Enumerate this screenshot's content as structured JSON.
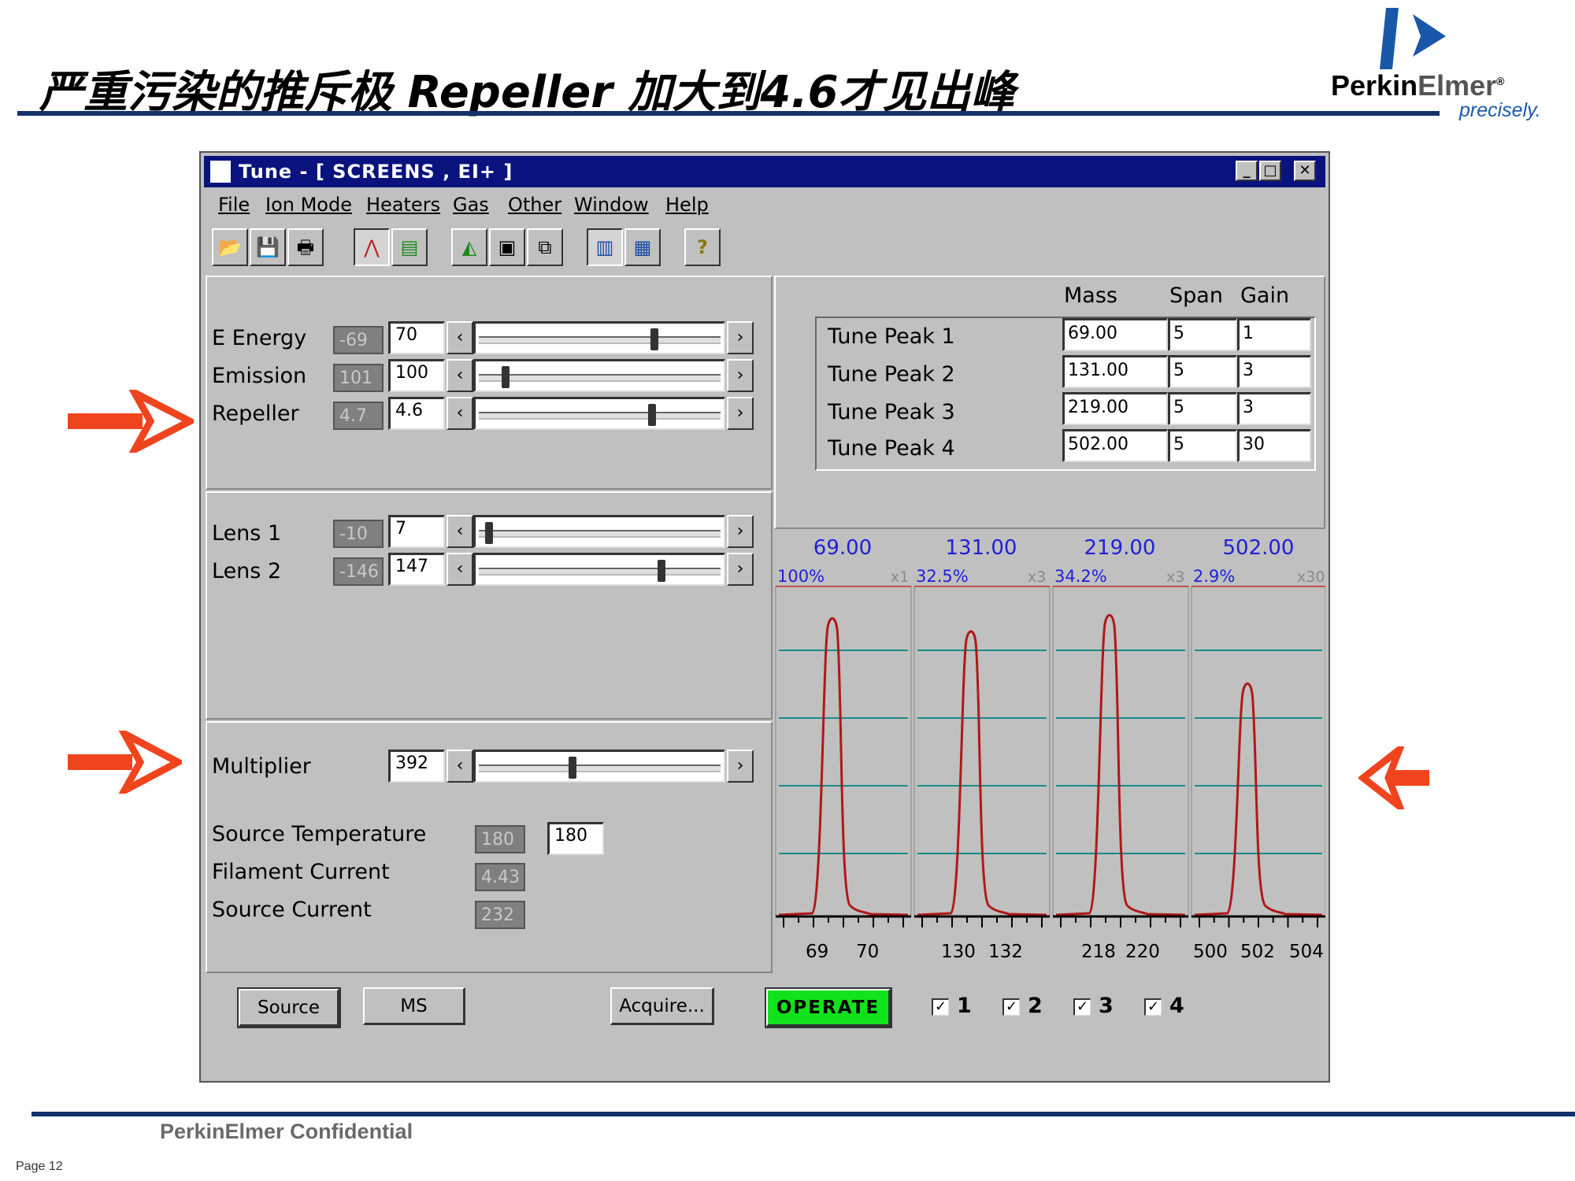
{
  "slide": {
    "title": "严重污染的推斥极    Repeller 加大到4.6才见出峰",
    "logo_name_bold": "Perkin",
    "logo_name_light": "Elmer",
    "logo_reg": "®",
    "logo_tagline": "precisely.",
    "footer": "PerkinElmer Confidential",
    "page": "Page 12"
  },
  "window": {
    "title": "Tune - [ SCREENS , EI+ ]",
    "controls": {
      "minimize": "_",
      "maximize": "□",
      "close": "✕"
    }
  },
  "menu": [
    "File",
    "Ion Mode",
    "Heaters",
    "Gas",
    "Other",
    "Window",
    "Help"
  ],
  "toolbar": [
    {
      "name": "open-icon",
      "glyph": "📂"
    },
    {
      "name": "save-icon",
      "glyph": "💾"
    },
    {
      "name": "print-icon",
      "glyph": "🖶"
    },
    {
      "name": "peak-icon",
      "glyph": "⋀"
    },
    {
      "name": "bars-icon",
      "glyph": "▤"
    },
    {
      "name": "spectrum-icon",
      "glyph": "◭"
    },
    {
      "name": "graph-icon",
      "glyph": "▣"
    },
    {
      "name": "link-icon",
      "glyph": "⧉"
    },
    {
      "name": "readback-icon",
      "glyph": "▥"
    },
    {
      "name": "scale-icon",
      "glyph": "▦"
    },
    {
      "name": "help-icon",
      "glyph": "?"
    }
  ],
  "source": [
    {
      "label": "E Energy",
      "readback": "-69",
      "value": "70",
      "slider_fraction": 0.73
    },
    {
      "label": "Emission",
      "readback": "101",
      "value": "100",
      "slider_fraction": 0.09
    },
    {
      "label": "Repeller",
      "readback": "4.7",
      "value": "4.6",
      "slider_fraction": 0.72
    }
  ],
  "lenses": [
    {
      "label": "Lens 1",
      "readback": "-10",
      "value": "7",
      "slider_fraction": 0.02
    },
    {
      "label": "Lens 2",
      "readback": "-146",
      "value": "147",
      "slider_fraction": 0.76
    }
  ],
  "multiplier": {
    "label": "Multiplier",
    "value": "392",
    "slider_fraction": 0.38
  },
  "status": {
    "source_temp_label": "Source Temperature",
    "source_temp_readback": "180",
    "source_temp_value": "180",
    "filament_label": "Filament Current",
    "filament_readback": "4.43",
    "source_current_label": "Source Current",
    "source_current_readback": "232"
  },
  "tune_table": {
    "headers": {
      "mass": "Mass",
      "span": "Span",
      "gain": "Gain"
    },
    "rows": [
      {
        "label": "Tune Peak 1",
        "mass": "69.00",
        "span": "5",
        "gain": "1"
      },
      {
        "label": "Tune Peak 2",
        "mass": "131.00",
        "span": "5",
        "gain": "3"
      },
      {
        "label": "Tune Peak 3",
        "mass": "219.00",
        "span": "5",
        "gain": "3"
      },
      {
        "label": "Tune Peak 4",
        "mass": "502.00",
        "span": "5",
        "gain": "30"
      }
    ]
  },
  "peaks": [
    {
      "mass": "69.00",
      "percent": "100%",
      "mult": "x1",
      "ticks": [
        "69",
        "70"
      ],
      "height": 0.91
    },
    {
      "mass": "131.00",
      "percent": "32.5%",
      "mult": "x3",
      "ticks": [
        "130",
        "132"
      ],
      "height": 0.87
    },
    {
      "mass": "219.00",
      "percent": "34.2%",
      "mult": "x3",
      "ticks": [
        "218",
        "220"
      ],
      "height": 0.92
    },
    {
      "mass": "502.00",
      "percent": "2.9%",
      "mult": "x30",
      "ticks": [
        "500",
        "502",
        "504"
      ],
      "height": 0.71
    }
  ],
  "buttons": {
    "source": "Source",
    "ms": "MS",
    "acquire": "Acquire...",
    "operate": "OPERATE"
  },
  "checks": [
    {
      "label": "1",
      "checked": "✓"
    },
    {
      "label": "2",
      "checked": "✓"
    },
    {
      "label": "3",
      "checked": "✓"
    },
    {
      "label": "4",
      "checked": "✓"
    }
  ],
  "colors": {
    "accent_arrow": "#f0441e",
    "peak_trace": "#b01818",
    "grid": "#1a8a8a",
    "peak_text": "#2020d8",
    "operate": "#12e21b"
  }
}
